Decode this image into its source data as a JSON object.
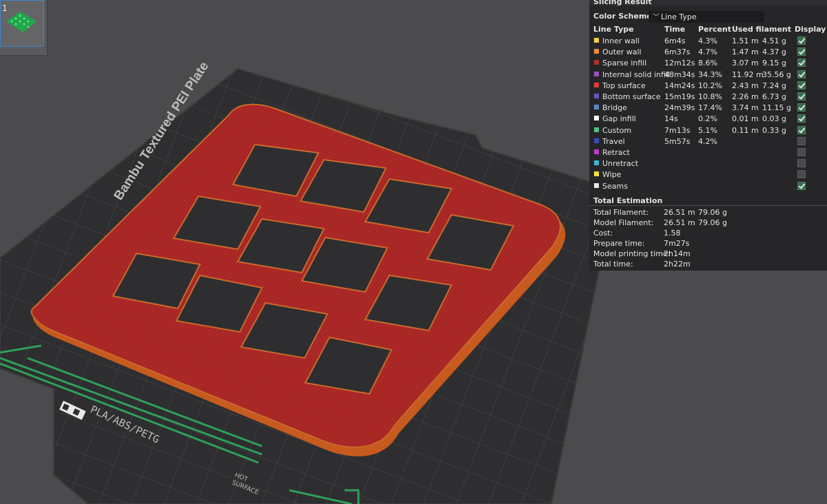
{
  "thumbnail": {
    "plate_number": "1"
  },
  "plate": {
    "name": "Bambu Textured PEI Plate",
    "material_label": "PLA/ABS/PETG",
    "hot_label_1": "HOT",
    "hot_label_2": "SURFACE"
  },
  "panel": {
    "title": "Slicing Result",
    "color_scheme_label": "Color Scheme",
    "color_scheme_value": "Line Type",
    "headers": {
      "line_type": "Line Type",
      "time": "Time",
      "percent": "Percent",
      "used_filament": "Used filament",
      "display": "Display"
    },
    "rows": [
      {
        "name": "Inner wall",
        "color": "#f7d13a",
        "time": "6m4s",
        "percent": "4.3%",
        "meters": "1.51 m",
        "grams": "4.51 g",
        "display": true
      },
      {
        "name": "Outer wall",
        "color": "#f08a3a",
        "time": "6m37s",
        "percent": "4.7%",
        "meters": "1.47 m",
        "grams": "4.37 g",
        "display": true
      },
      {
        "name": "Sparse infill",
        "color": "#b1322c",
        "time": "12m12s",
        "percent": "8.6%",
        "meters": "3.07 m",
        "grams": "9.15 g",
        "display": true
      },
      {
        "name": "Internal solid infill",
        "color": "#9a4ec6",
        "time": "48m34s",
        "percent": "34.3%",
        "meters": "11.92 m",
        "grams": "35.56 g",
        "display": true
      },
      {
        "name": "Top surface",
        "color": "#e0403a",
        "time": "14m24s",
        "percent": "10.2%",
        "meters": "2.43 m",
        "grams": "7.24 g",
        "display": true
      },
      {
        "name": "Bottom surface",
        "color": "#6a55c2",
        "time": "15m19s",
        "percent": "10.8%",
        "meters": "2.26 m",
        "grams": "6.73 g",
        "display": true
      },
      {
        "name": "Bridge",
        "color": "#5a86c8",
        "time": "24m39s",
        "percent": "17.4%",
        "meters": "3.74 m",
        "grams": "11.15 g",
        "display": true
      },
      {
        "name": "Gap infill",
        "color": "#ffffff",
        "time": "14s",
        "percent": "0.2%",
        "meters": "0.01 m",
        "grams": "0.03 g",
        "display": true
      },
      {
        "name": "Custom",
        "color": "#4ec27a",
        "time": "7m13s",
        "percent": "5.1%",
        "meters": "0.11 m",
        "grams": "0.33 g",
        "display": true
      },
      {
        "name": "Travel",
        "color": "#3a4fbf",
        "time": "5m57s",
        "percent": "4.2%",
        "meters": "",
        "grams": "",
        "display": false
      },
      {
        "name": "Retract",
        "color": "#c43ad0",
        "time": "",
        "percent": "",
        "meters": "",
        "grams": "",
        "display": false
      },
      {
        "name": "Unretract",
        "color": "#3ab7d0",
        "time": "",
        "percent": "",
        "meters": "",
        "grams": "",
        "display": false
      },
      {
        "name": "Wipe",
        "color": "#f5e23a",
        "time": "",
        "percent": "",
        "meters": "",
        "grams": "",
        "display": false
      },
      {
        "name": "Seams",
        "color": "#e8e8e8",
        "time": "",
        "percent": "",
        "meters": "",
        "grams": "",
        "display": true
      }
    ],
    "total_estimation": {
      "title": "Total Estimation",
      "items": [
        {
          "label": "Total Filament:",
          "v1": "26.51 m",
          "v2": "79.06 g"
        },
        {
          "label": "Model Filament:",
          "v1": "26.51 m",
          "v2": "79.06 g"
        },
        {
          "label": "Cost:",
          "v1": "1.58",
          "v2": ""
        },
        {
          "label": "Prepare time:",
          "v1": "7m27s",
          "v2": ""
        },
        {
          "label": "Model printing time:",
          "v1": "2h14m",
          "v2": ""
        },
        {
          "label": "Total time:",
          "v1": "2h22m",
          "v2": ""
        }
      ]
    }
  }
}
